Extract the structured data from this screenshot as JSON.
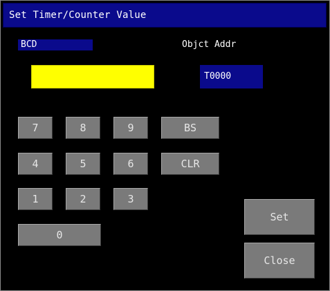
{
  "window": {
    "title": "Set Timer/Counter Value"
  },
  "mode": {
    "label": "BCD"
  },
  "object": {
    "label": "Objct Addr",
    "address": "T0000"
  },
  "value": {
    "text": ""
  },
  "keypad": {
    "k7": "7",
    "k8": "8",
    "k9": "9",
    "bs": "BS",
    "k4": "4",
    "k5": "5",
    "k6": "6",
    "clr": "CLR",
    "k1": "1",
    "k2": "2",
    "k3": "3",
    "k0": "0"
  },
  "actions": {
    "set": "Set",
    "close": "Close"
  },
  "colors": {
    "background": "#000000",
    "title_bar": "#0a0a8c",
    "value_field": "#ffff00",
    "key": "#7a7a7a",
    "text": "#ffffff"
  }
}
